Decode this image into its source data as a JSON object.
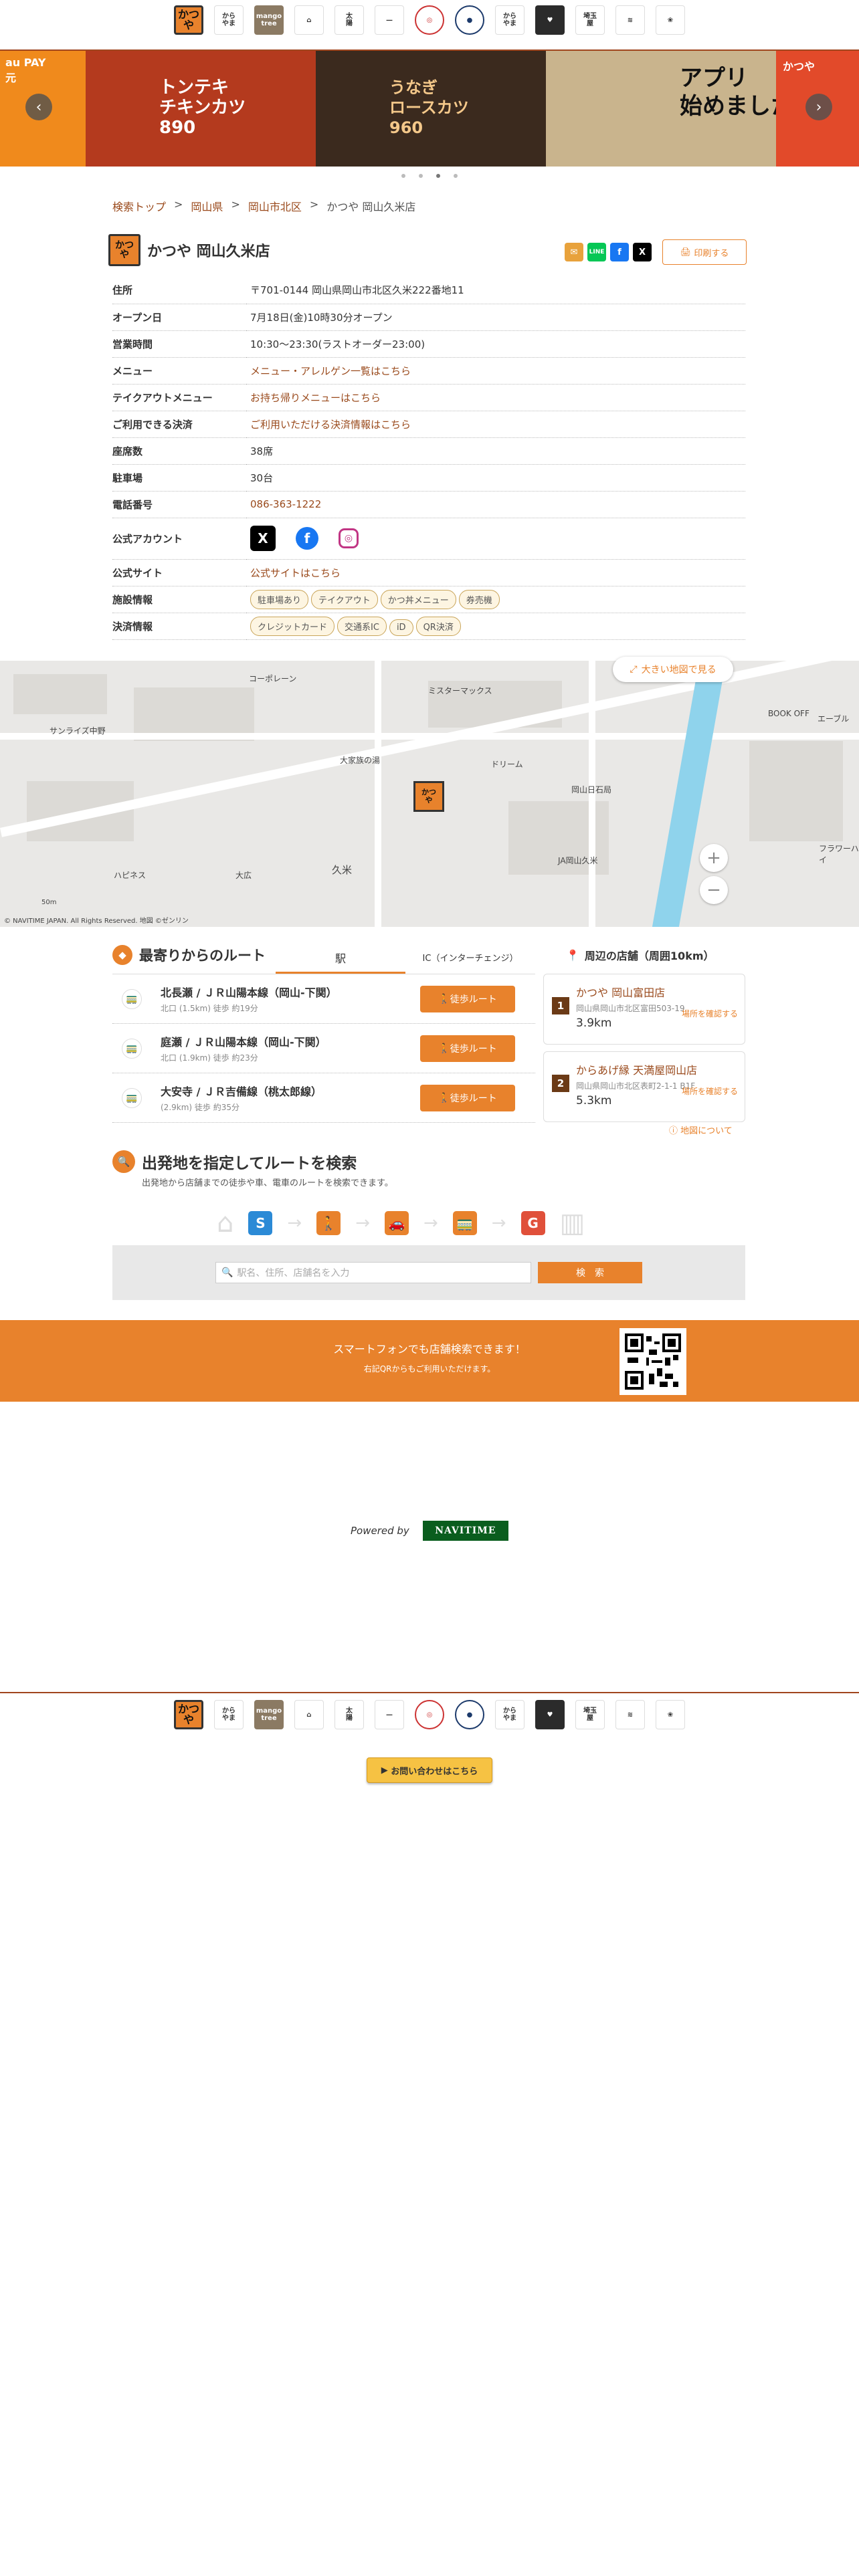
{
  "brands": [
    {
      "name": "かつや",
      "label": "かつ\nや"
    },
    {
      "name": "からやま",
      "label": "から\nやま"
    },
    {
      "name": "mango tree",
      "label": "mango\ntree"
    },
    {
      "name": "brand-4",
      "label": "⌂"
    },
    {
      "name": "brand-5",
      "label": "太\n陽"
    },
    {
      "name": "brand-6",
      "label": "—"
    },
    {
      "name": "brand-7",
      "label": "◎"
    },
    {
      "name": "brand-8",
      "label": "●"
    },
    {
      "name": "かつや2",
      "label": "から\nやま"
    },
    {
      "name": "brand-10",
      "label": "♥"
    },
    {
      "name": "埼玉屋",
      "label": "埼玉\n屋"
    },
    {
      "name": "brand-12",
      "label": "≋"
    },
    {
      "name": "brand-13",
      "label": "❀"
    }
  ],
  "carousel": {
    "slides": [
      {
        "text": "au PAY\n元",
        "bg": "#f08a1c"
      },
      {
        "text": "トンテキ\nチキンカツ\n890",
        "bg": "#b43a1e"
      },
      {
        "text": "うなぎ\nロースカツ\n960",
        "bg": "#3b2a1e"
      },
      {
        "text": "アプリ\n始めました。",
        "bg": "#c9b48d"
      },
      {
        "text": "かつや",
        "bg": "#e24a2a"
      }
    ],
    "prev": "‹",
    "next": "›"
  },
  "breadcrumb": {
    "items": [
      "検索トップ",
      "岡山県",
      "岡山市北区"
    ],
    "current": "かつや 岡山久米店",
    "sep": ">"
  },
  "store": {
    "logo": "かつ\nや",
    "title": "かつや 岡山久米店",
    "print": "印刷する"
  },
  "info": {
    "address_label": "住所",
    "address": "〒701-0144 岡山県岡山市北区久米222番地11",
    "open_label": "オープン日",
    "open": "7月18日(金)10時30分オープン",
    "hours_label": "営業時間",
    "hours": "10:30〜23:30(ラストオーダー23:00)",
    "menu_label": "メニュー",
    "menu": "メニュー・アレルゲン一覧はこちら",
    "takeout_label": "テイクアウトメニュー",
    "takeout": "お持ち帰りメニューはこちら",
    "payment_label": "ご利用できる決済",
    "payment": "ご利用いただける決済情報はこちら",
    "seats_label": "座席数",
    "seats": "38席",
    "parking_label": "駐車場",
    "parking": "30台",
    "phone_label": "電話番号",
    "phone": "086-363-1222",
    "accounts_label": "公式アカウント",
    "site_label": "公式サイト",
    "site": "公式サイトはこちら",
    "facilities_label": "施設情報",
    "facilities": [
      "駐車場あり",
      "テイクアウト",
      "かつ丼メニュー",
      "券売機"
    ],
    "settlement_label": "決済情報",
    "settlement": [
      "クレジットカード",
      "交通系IC",
      "iD",
      "QR決済"
    ]
  },
  "map": {
    "bigmap": "大きい地図で見る",
    "labels": [
      "コーポレーン",
      "サンライズ中野",
      "ミスターマックス",
      "大家族の湯",
      "ドリーム",
      "ハピネス",
      "大広",
      "久米",
      "岡山日石局",
      "JA岡山久米",
      "BOOK OFF",
      "エーブル",
      "フラワーハイ",
      "50m"
    ],
    "copyright": "© NAVITIME JAPAN. All Rights Reserved. 地図 ©ゼンリン"
  },
  "routes": {
    "title": "最寄りからのルート",
    "tab_station": "駅",
    "tab_ic": "IC（インターチェンジ）",
    "button": "徒歩ルート",
    "items": [
      {
        "station": "北長瀬 / ＪＲ山陽本線（岡山-下関）",
        "detail": "北口 (1.5km) 徒歩 約19分"
      },
      {
        "station": "庭瀬 / ＪＲ山陽本線（岡山-下関）",
        "detail": "北口 (1.9km) 徒歩 約23分"
      },
      {
        "station": "大安寺 / ＪＲ吉備線（桃太郎線）",
        "detail": "(2.9km) 徒歩 約35分"
      }
    ]
  },
  "nearby": {
    "title": "周辺の店舗（周囲10km）",
    "check": "場所を確認する",
    "about": "地図について",
    "items": [
      {
        "num": "1",
        "name": "かつや 岡山富田店",
        "addr": "岡山県岡山市北区富田503-19",
        "dist": "3.9km"
      },
      {
        "num": "2",
        "name": "からあげ縁 天満屋岡山店",
        "addr": "岡山県岡山市北区表町2-1-1 B1F",
        "dist": "5.3km"
      }
    ]
  },
  "routesearch": {
    "title": "出発地を指定してルートを検索",
    "desc": "出発地から店舗までの徒歩や車、電車のルートを検索できます。",
    "placeholder": "駅名、住所、店舗名を入力",
    "button": "検　索",
    "steps": [
      {
        "letter": "S",
        "color": "#2b8ad6"
      },
      {
        "letter": "🚶",
        "color": "#e8822c"
      },
      {
        "letter": "🚗",
        "color": "#e8822c"
      },
      {
        "letter": "🚃",
        "color": "#e8822c"
      },
      {
        "letter": "G",
        "color": "#e0503a"
      }
    ]
  },
  "smartphone": {
    "line1": "スマートフォンでも店舗検索できます！",
    "line2": "右記QRからもご利用いただけます。"
  },
  "footer": {
    "powered": "Powered by",
    "navitime": "NAVITIME",
    "contact": "お問い合わせはこちら"
  }
}
